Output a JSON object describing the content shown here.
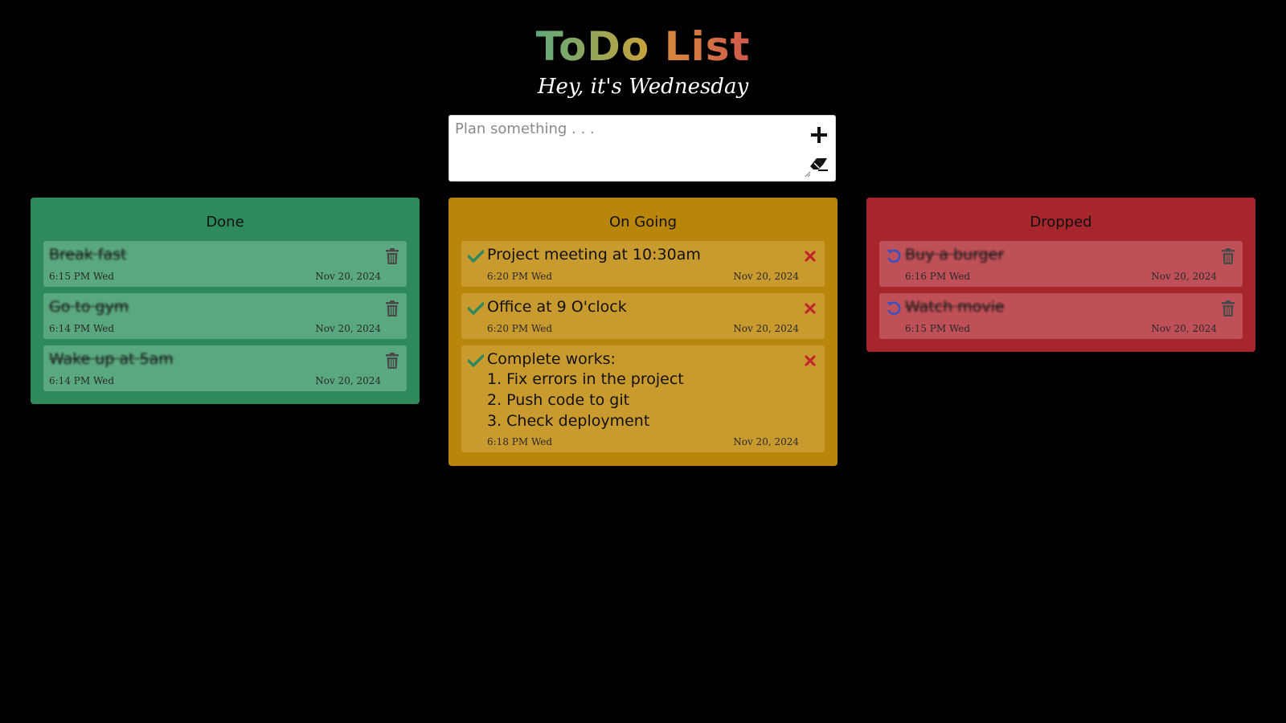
{
  "header": {
    "title_words": [
      "ToDo",
      "List"
    ],
    "title_colors": [
      "#5fa87a",
      "#c9a33a",
      "#d06a50"
    ],
    "subtitle": "Hey, it's Wednesday"
  },
  "composer": {
    "placeholder": "Plan something . . .",
    "value": ""
  },
  "columns": {
    "done": {
      "title": "Done",
      "color": "#2e8a5c",
      "items": [
        {
          "text": "Break fast",
          "time": "6:15 PM Wed",
          "date": "Nov 20, 2024"
        },
        {
          "text": "Go to gym",
          "time": "6:14 PM Wed",
          "date": "Nov 20, 2024"
        },
        {
          "text": "Wake up at 5am",
          "time": "6:14 PM Wed",
          "date": "Nov 20, 2024"
        }
      ]
    },
    "ongoing": {
      "title": "On Going",
      "color": "#b8860b",
      "items": [
        {
          "text": "Project meeting at 10:30am",
          "time": "6:20 PM Wed",
          "date": "Nov 20, 2024"
        },
        {
          "text": "Office at 9 O'clock",
          "time": "6:20 PM Wed",
          "date": "Nov 20, 2024"
        },
        {
          "text": "Complete works:",
          "subitems": [
            "1.  Fix errors in the project",
            "2. Push code to git",
            "3. Check deployment"
          ],
          "time": "6:18 PM Wed",
          "date": "Nov 20, 2024"
        }
      ]
    },
    "dropped": {
      "title": "Dropped",
      "color": "#a6262c",
      "items": [
        {
          "text": "Buy a burger",
          "time": "6:16 PM Wed",
          "date": "Nov 20, 2024"
        },
        {
          "text": "Watch movie",
          "time": "6:15 PM Wed",
          "date": "Nov 20, 2024"
        }
      ]
    }
  },
  "icons": {
    "add": "plus-icon",
    "clear": "eraser-icon",
    "delete": "trash-icon",
    "complete": "check-icon",
    "drop": "close-icon",
    "restore": "undo-icon"
  },
  "accent_colors": {
    "check": "#2e8a5c",
    "close": "#c0282e",
    "undo": "#3a4fc0",
    "trash": "#4a4a4a"
  }
}
